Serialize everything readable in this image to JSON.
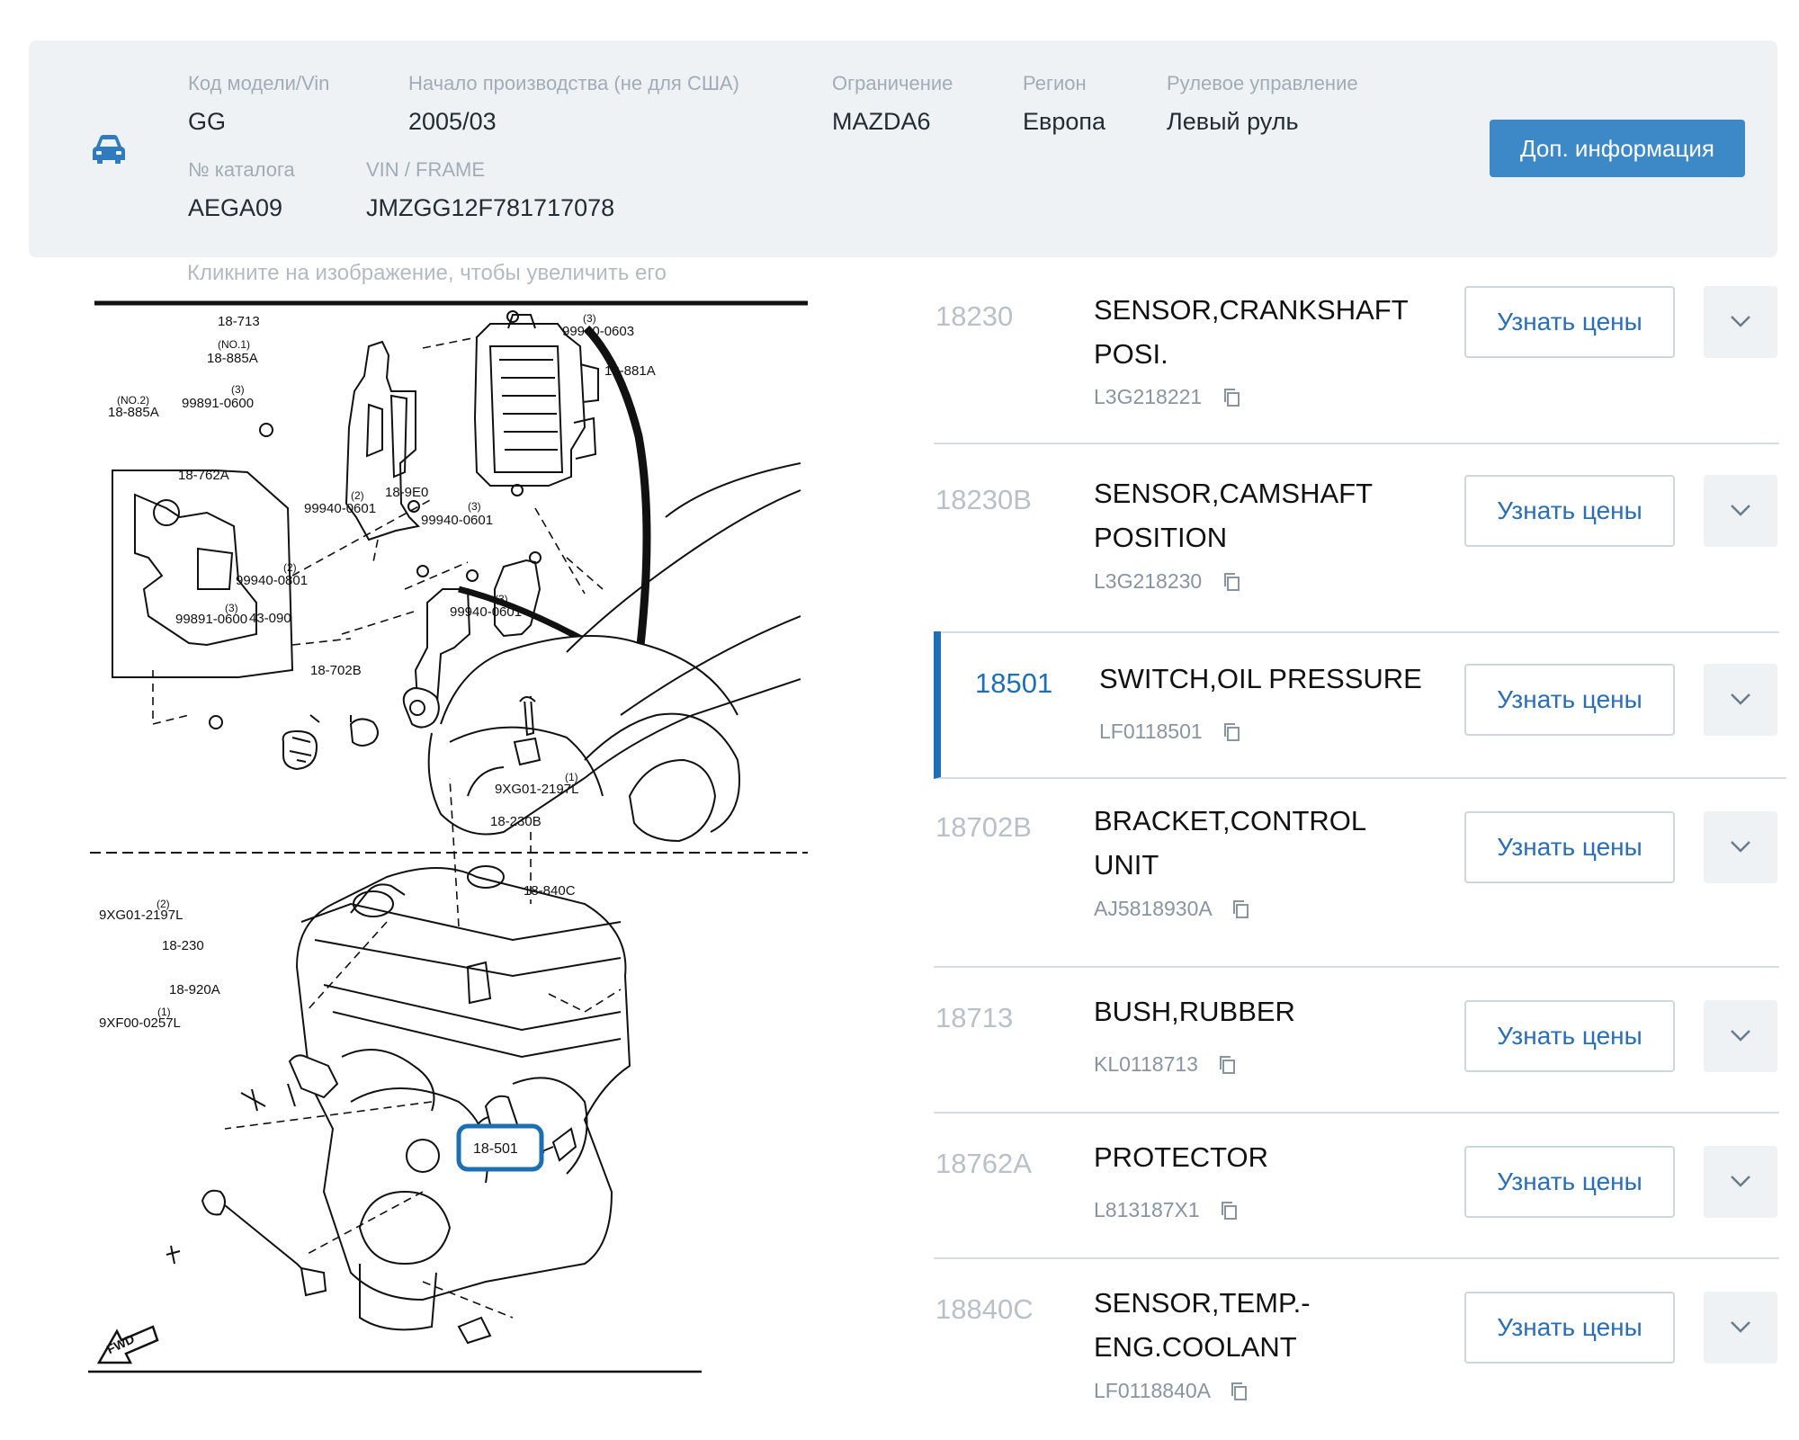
{
  "vehicle": {
    "icon": "car-icon",
    "fields": [
      {
        "label": "Код модели/Vin",
        "value": "GG"
      },
      {
        "label": "Начало производства (не для США)",
        "value": "2005/03"
      },
      {
        "label": "Ограничение",
        "value": "MAZDA6"
      },
      {
        "label": "Регион",
        "value": "Европа"
      },
      {
        "label": "Рулевое управление",
        "value": "Левый руль"
      },
      {
        "label": "№ каталога",
        "value": "AEGA09"
      },
      {
        "label": "VIN / FRAME",
        "value": "JMZGG12F781717078"
      }
    ],
    "more_button": "Доп. информация"
  },
  "hint": "Кликните на изображение, чтобы увеличить его",
  "diagram": {
    "labels": [
      "18-713",
      "99940-0603",
      "(3)",
      "(NO.1)",
      "18-885A",
      "18-881A",
      "(NO.2)",
      "18-885A",
      "99891-0600",
      "(3)",
      "18-762A",
      "18-9E0",
      "99940-0601",
      "(2)",
      "99940-0601",
      "(3)",
      "99940-0801",
      "(2)",
      "99940-0601",
      "(3)",
      "99891-0600",
      "(3)",
      "43-090",
      "18-702B",
      "9XG01-2197L",
      "(1)",
      "18-230B",
      "18-840C",
      "9XG01-2197L",
      "(2)",
      "18-230",
      "18-920A",
      "9XF00-0257L",
      "(1)",
      "FWD"
    ],
    "highlight_label": "18-501"
  },
  "parts": [
    {
      "code": "18230",
      "name": "SENSOR,CRANKSHAFT POSI.",
      "number": "L3G218221",
      "price_button": "Узнать цены",
      "active": false
    },
    {
      "code": "18230B",
      "name": "SENSOR,CAMSHAFT POSITION",
      "number": "L3G218230",
      "price_button": "Узнать цены",
      "active": false
    },
    {
      "code": "18501",
      "name": "SWITCH,OIL PRESSURE",
      "number": "LF0118501",
      "price_button": "Узнать цены",
      "active": true
    },
    {
      "code": "18702B",
      "name": "BRACKET,CONTROL UNIT",
      "number": "AJ5818930A",
      "price_button": "Узнать цены",
      "active": false
    },
    {
      "code": "18713",
      "name": "BUSH,RUBBER",
      "number": "KL0118713",
      "price_button": "Узнать цены",
      "active": false
    },
    {
      "code": "18762A",
      "name": "PROTECTOR",
      "number": "L813187X1",
      "price_button": "Узнать цены",
      "active": false
    },
    {
      "code": "18840C",
      "name": "SENSOR,TEMP.-ENG.COOLANT",
      "number": "LF0118840A",
      "price_button": "Узнать цены",
      "active": false
    }
  ],
  "colors": {
    "panel_bg": "#eef2f5",
    "primary": "#3d89c8",
    "accent": "#1f6fb7",
    "highlight_box": "#1c6fb3"
  }
}
